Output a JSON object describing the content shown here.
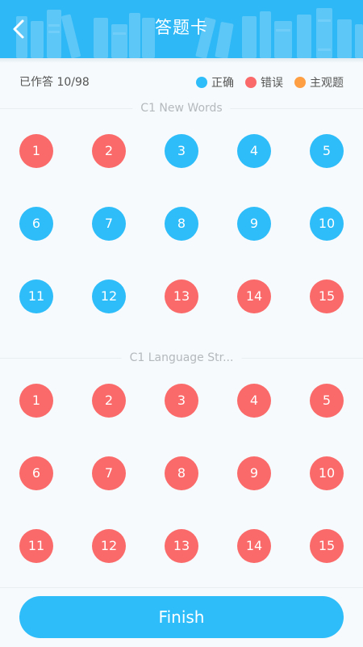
{
  "header": {
    "title": "答题卡",
    "back_icon": "chevron-left-icon"
  },
  "status": {
    "progress": "已作答 10/98",
    "legend": [
      {
        "label": "正确",
        "color": "#2fbdf9"
      },
      {
        "label": "错误",
        "color": "#fb6a6a"
      },
      {
        "label": "主观题",
        "color": "#ff9f43"
      }
    ]
  },
  "colors": {
    "correct": "#2fbdf9",
    "wrong": "#fb6a6a",
    "subjective": "#ff9f43",
    "header": "#2fb8f6"
  },
  "sections": [
    {
      "title": "C1 New Words",
      "questions": [
        {
          "number": "1",
          "status": "wrong"
        },
        {
          "number": "2",
          "status": "wrong"
        },
        {
          "number": "3",
          "status": "correct"
        },
        {
          "number": "4",
          "status": "correct"
        },
        {
          "number": "5",
          "status": "correct"
        },
        {
          "number": "6",
          "status": "correct"
        },
        {
          "number": "7",
          "status": "correct"
        },
        {
          "number": "8",
          "status": "correct"
        },
        {
          "number": "9",
          "status": "correct"
        },
        {
          "number": "10",
          "status": "correct"
        },
        {
          "number": "11",
          "status": "correct"
        },
        {
          "number": "12",
          "status": "correct"
        },
        {
          "number": "13",
          "status": "wrong"
        },
        {
          "number": "14",
          "status": "wrong"
        },
        {
          "number": "15",
          "status": "wrong"
        }
      ]
    },
    {
      "title": "C1 Language Str...",
      "questions": [
        {
          "number": "1",
          "status": "wrong"
        },
        {
          "number": "2",
          "status": "wrong"
        },
        {
          "number": "3",
          "status": "wrong"
        },
        {
          "number": "4",
          "status": "wrong"
        },
        {
          "number": "5",
          "status": "wrong"
        },
        {
          "number": "6",
          "status": "wrong"
        },
        {
          "number": "7",
          "status": "wrong"
        },
        {
          "number": "8",
          "status": "wrong"
        },
        {
          "number": "9",
          "status": "wrong"
        },
        {
          "number": "10",
          "status": "wrong"
        },
        {
          "number": "11",
          "status": "wrong"
        },
        {
          "number": "12",
          "status": "wrong"
        },
        {
          "number": "13",
          "status": "wrong"
        },
        {
          "number": "14",
          "status": "wrong"
        },
        {
          "number": "15",
          "status": "wrong"
        }
      ]
    }
  ],
  "footer": {
    "finish_label": "Finish"
  }
}
